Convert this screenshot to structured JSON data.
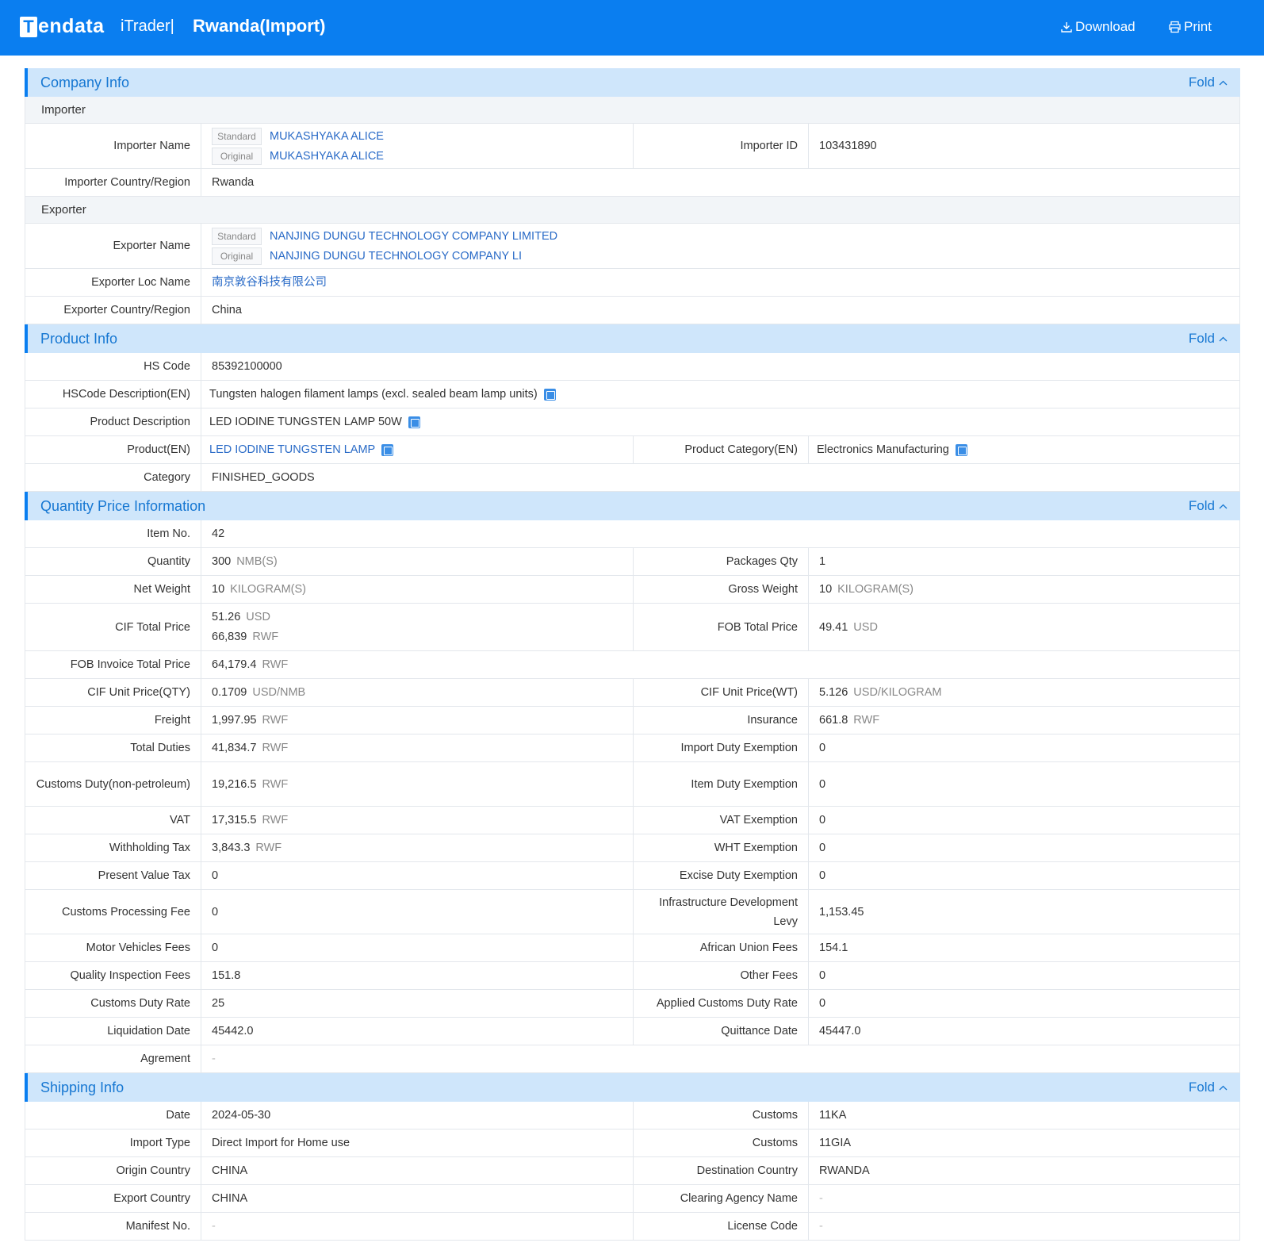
{
  "header": {
    "logo_mark": "T",
    "logo_text": "endata",
    "product": "iTrader|",
    "title": "Rwanda(Import)",
    "download_label": "Download",
    "print_label": "Print"
  },
  "fold_label": "Fold",
  "tags": {
    "standard": "Standard",
    "original": "Original"
  },
  "company": {
    "title": "Company Info",
    "importer_heading": "Importer",
    "importer_name_label": "Importer Name",
    "importer_name_standard": "MUKASHYAKA ALICE",
    "importer_name_original": "MUKASHYAKA ALICE",
    "importer_id_label": "Importer ID",
    "importer_id": "103431890",
    "importer_country_label": "Importer Country/Region",
    "importer_country": "Rwanda",
    "exporter_heading": "Exporter",
    "exporter_name_label": "Exporter Name",
    "exporter_name_standard": "NANJING DUNGU TECHNOLOGY COMPANY LIMITED",
    "exporter_name_original": "NANJING DUNGU TECHNOLOGY COMPANY LI",
    "exporter_loc_label": "Exporter Loc Name",
    "exporter_loc": "南京敦谷科技有限公司",
    "exporter_country_label": "Exporter Country/Region",
    "exporter_country": "China"
  },
  "product": {
    "title": "Product Info",
    "hs_code_label": "HS Code",
    "hs_code": "85392100000",
    "hs_desc_label": "HSCode Description(EN)",
    "hs_desc": "Tungsten halogen filament lamps (excl. sealed beam lamp units)",
    "desc_label": "Product Description",
    "desc": "LED IODINE TUNGSTEN LAMP 50W",
    "product_en_label": "Product(EN)",
    "product_en": "LED IODINE TUNGSTEN LAMP",
    "category_en_label": "Product Category(EN)",
    "category_en": "Electronics Manufacturing",
    "category_label": "Category",
    "category": "FINISHED_GOODS"
  },
  "qty": {
    "title": "Quantity Price Information",
    "rows": {
      "item_no": {
        "label": "Item No.",
        "value": "42"
      },
      "quantity": {
        "label": "Quantity",
        "value": "300",
        "unit": "NMB(S)"
      },
      "packages": {
        "label": "Packages Qty",
        "value": "1"
      },
      "net_weight": {
        "label": "Net Weight",
        "value": "10",
        "unit": "KILOGRAM(S)"
      },
      "gross_weight": {
        "label": "Gross Weight",
        "value": "10",
        "unit": "KILOGRAM(S)"
      },
      "cif_total": {
        "label": "CIF Total Price",
        "value1": "51.26",
        "unit1": "USD",
        "value2": "66,839",
        "unit2": "RWF"
      },
      "fob_total": {
        "label": "FOB Total Price",
        "value": "49.41",
        "unit": "USD"
      },
      "fob_invoice": {
        "label": "FOB Invoice Total Price",
        "value": "64,179.4",
        "unit": "RWF"
      },
      "cif_unit_qty": {
        "label": "CIF Unit Price(QTY)",
        "value": "0.1709",
        "unit": "USD/NMB"
      },
      "cif_unit_wt": {
        "label": "CIF Unit Price(WT)",
        "value": "5.126",
        "unit": "USD/KILOGRAM"
      },
      "freight": {
        "label": "Freight",
        "value": "1,997.95",
        "unit": "RWF"
      },
      "insurance": {
        "label": "Insurance",
        "value": "661.8",
        "unit": "RWF"
      },
      "total_duties": {
        "label": "Total Duties",
        "value": "41,834.7",
        "unit": "RWF"
      },
      "import_duty_ex": {
        "label": "Import Duty Exemption",
        "value": "0"
      },
      "customs_duty": {
        "label": "Customs Duty(non-petroleum)",
        "value": "19,216.5",
        "unit": "RWF"
      },
      "item_duty_ex": {
        "label": "Item Duty Exemption",
        "value": "0"
      },
      "vat": {
        "label": "VAT",
        "value": "17,315.5",
        "unit": "RWF"
      },
      "vat_ex": {
        "label": "VAT Exemption",
        "value": "0"
      },
      "withholding": {
        "label": "Withholding Tax",
        "value": "3,843.3",
        "unit": "RWF"
      },
      "wht_ex": {
        "label": "WHT Exemption",
        "value": "0"
      },
      "present_value": {
        "label": "Present Value Tax",
        "value": "0"
      },
      "excise_ex": {
        "label": "Excise Duty Exemption",
        "value": "0"
      },
      "processing_fee": {
        "label": "Customs Processing Fee",
        "value": "0"
      },
      "infra_levy": {
        "label": "Infrastructure Development Levy",
        "value": "1,153.45"
      },
      "motor_fees": {
        "label": "Motor Vehicles Fees",
        "value": "0"
      },
      "au_fees": {
        "label": "African Union Fees",
        "value": "154.1"
      },
      "quality_fees": {
        "label": "Quality Inspection Fees",
        "value": "151.8"
      },
      "other_fees": {
        "label": "Other Fees",
        "value": "0"
      },
      "duty_rate": {
        "label": "Customs Duty Rate",
        "value": "25"
      },
      "applied_rate": {
        "label": "Applied Customs Duty Rate",
        "value": "0"
      },
      "liquidation": {
        "label": "Liquidation Date",
        "value": "45442.0"
      },
      "quittance": {
        "label": "Quittance Date",
        "value": "45447.0"
      },
      "agreement": {
        "label": "Agrement",
        "value": "-"
      }
    }
  },
  "shipping": {
    "title": "Shipping Info",
    "rows": {
      "date": {
        "label": "Date",
        "value": "2024-05-30"
      },
      "customs1": {
        "label": "Customs",
        "value": "11KA"
      },
      "import_type": {
        "label": "Import Type",
        "value": "Direct Import for Home use"
      },
      "customs2": {
        "label": "Customs",
        "value": "11GIA"
      },
      "origin": {
        "label": "Origin Country",
        "value": "CHINA"
      },
      "destination": {
        "label": "Destination Country",
        "value": "RWANDA"
      },
      "export_country": {
        "label": "Export Country",
        "value": "CHINA"
      },
      "clearing": {
        "label": "Clearing Agency Name",
        "value": "-"
      },
      "manifest": {
        "label": "Manifest No.",
        "value": "-"
      },
      "license": {
        "label": "License Code",
        "value": "-"
      }
    }
  }
}
